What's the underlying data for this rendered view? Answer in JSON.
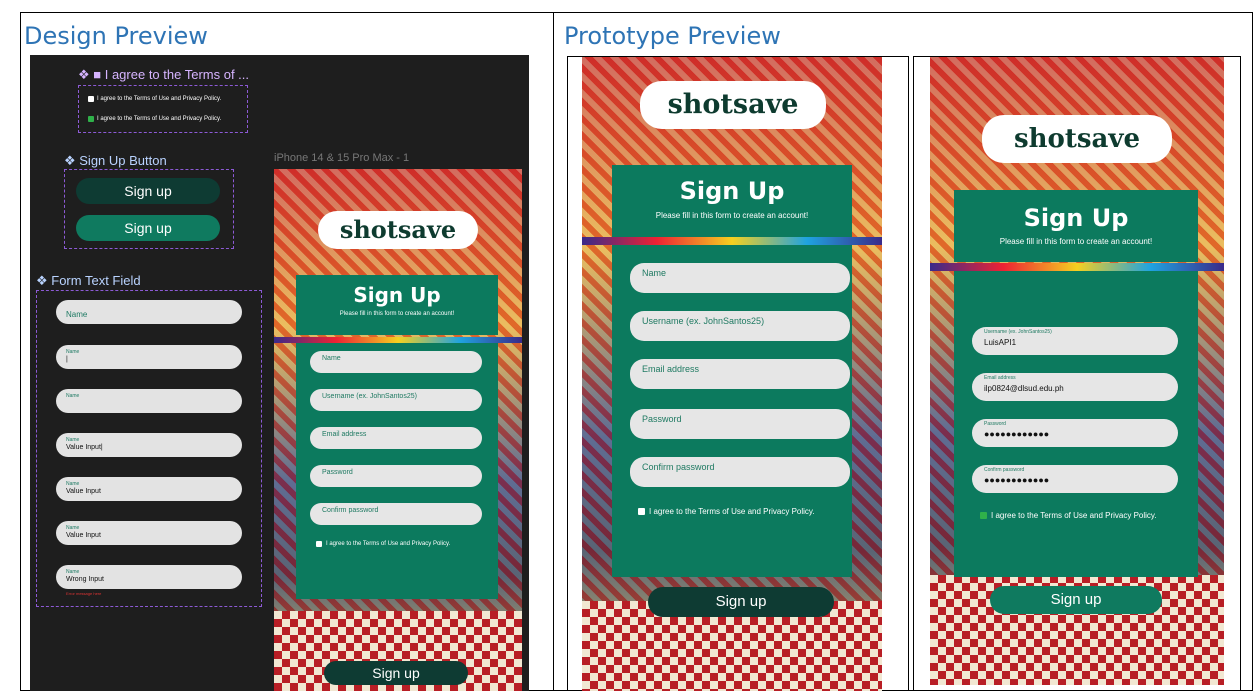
{
  "headings": {
    "design": "Design Preview",
    "prototype": "Prototype Preview"
  },
  "design": {
    "checkbox_component": "❖ ■ I agree to the Terms of ...",
    "checkbox_unchecked": "I agree to the Terms of Use and Privacy Policy.",
    "checkbox_checked": "I agree to the Terms of Use and Privacy Policy.",
    "button_component": "❖ Sign Up Button",
    "button_dark": "Sign up",
    "button_light": "Sign up",
    "textfield_component": "❖ Form Text Field",
    "fields": [
      {
        "label": "",
        "placeholder": "Name",
        "value": ""
      },
      {
        "label": "Name",
        "placeholder": "",
        "value": "|"
      },
      {
        "label": "Name",
        "placeholder": "",
        "value": ""
      },
      {
        "label": "Name",
        "placeholder": "",
        "value": "Value Input|"
      },
      {
        "label": "Name",
        "placeholder": "",
        "value": "Value Input"
      },
      {
        "label": "Name",
        "placeholder": "",
        "value": "Value Input"
      },
      {
        "label": "Name",
        "placeholder": "",
        "value": "Wrong Input"
      }
    ],
    "error_text": "Error message here",
    "frame_label": "iPhone 14 & 15 Pro Max - 1",
    "phone": {
      "logo": "shotsave",
      "title": "Sign Up",
      "subtitle": "Please fill in this form to create an account!",
      "fields": [
        "Name",
        "Username (ex. JohnSantos25)",
        "Email address",
        "Password",
        "Confirm password"
      ],
      "agree": "I agree to the Terms of Use and Privacy Policy.",
      "button": "Sign up"
    }
  },
  "prototype": {
    "empty": {
      "logo": "shotsave",
      "title": "Sign Up",
      "subtitle": "Please fill in this form to create an account!",
      "fields": [
        "Name",
        "Username (ex. JohnSantos25)",
        "Email address",
        "Password",
        "Confirm password"
      ],
      "agree": "I agree to the Terms of Use and Privacy Policy.",
      "button": "Sign up"
    },
    "filled": {
      "logo": "shotsave",
      "title": "Sign Up",
      "subtitle": "Please fill in this form to create an account!",
      "fields": [
        {
          "label": "Username (ex. JohnSantos25)",
          "value": "LuisAPI1"
        },
        {
          "label": "Email address",
          "value": "ilp0824@dlsud.edu.ph"
        },
        {
          "label": "Password",
          "value": "●●●●●●●●●●●●"
        },
        {
          "label": "Confirm password",
          "value": "●●●●●●●●●●●●"
        }
      ],
      "agree": "I agree to the Terms of Use and Privacy Policy.",
      "button": "Sign up"
    }
  },
  "colors": {
    "heading": "#2e74b5",
    "panel": "#0c7a5e",
    "button_dark": "#0e3b33",
    "button_light": "#0f7a5f",
    "canvas": "#1e1e1e"
  }
}
